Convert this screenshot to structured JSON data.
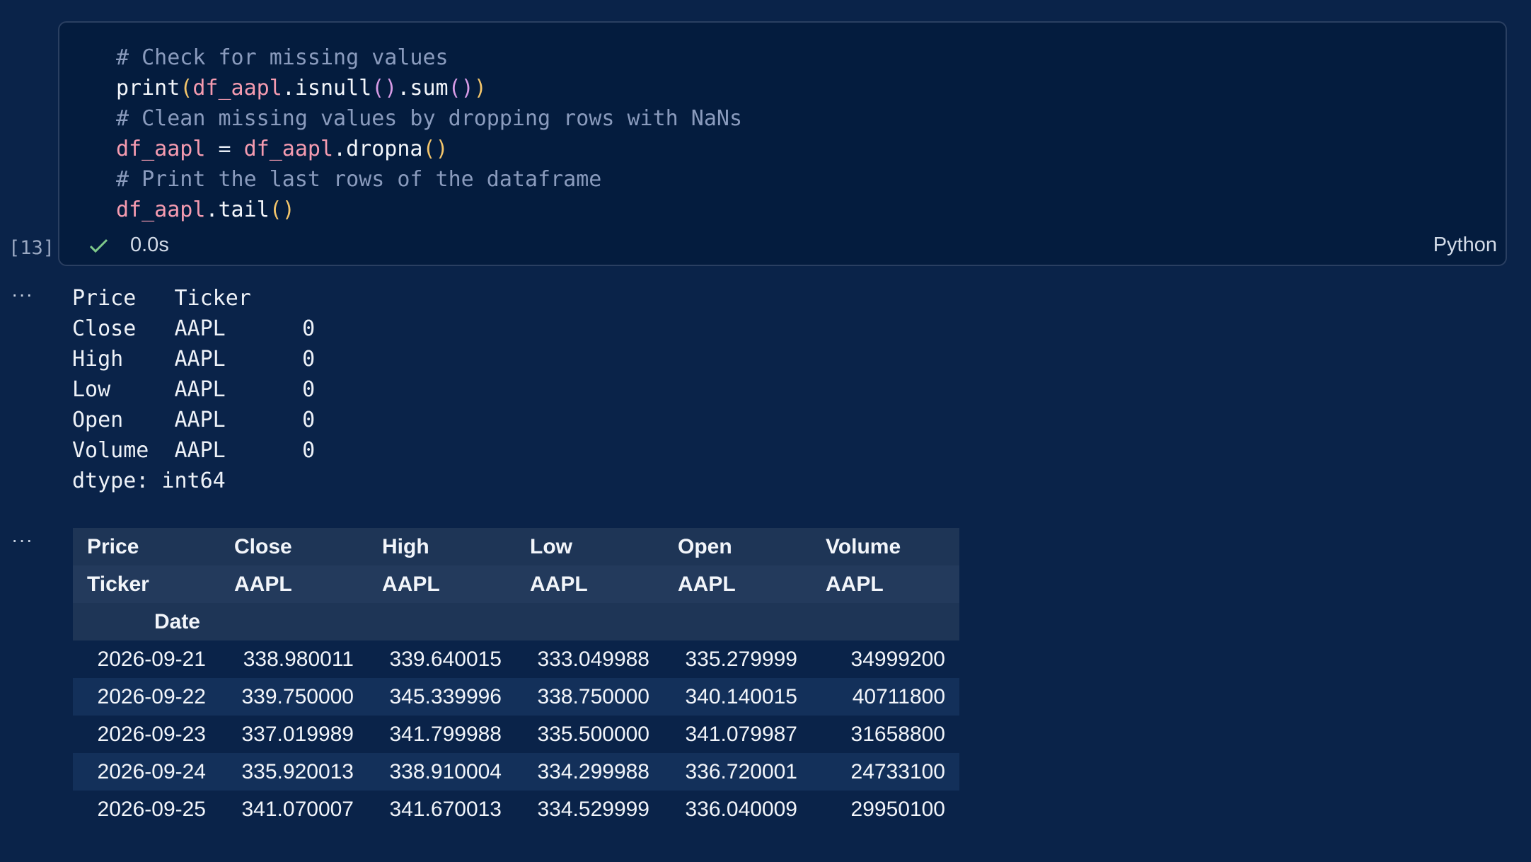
{
  "cell": {
    "execution_count": "[13]",
    "status_time": "0.0s",
    "language": "Python",
    "code": {
      "line1": "# Check for missing values",
      "line2": {
        "fn": "print",
        "var": "df_aapl",
        "method": ".isnull",
        "method2": ".sum"
      },
      "line3": "# Clean missing values by dropping rows with NaNs",
      "line4": {
        "target": "df_aapl",
        "eq": " = ",
        "var": "df_aapl",
        "method": ".dropna"
      },
      "line5": "# Print the last rows of the dataframe",
      "line6": {
        "var": "df_aapl",
        "method": ".tail"
      }
    }
  },
  "output_prompt": "···",
  "output1_text": "Price   Ticker\nClose   AAPL      0\nHigh    AAPL      0\nLow     AAPL      0\nOpen    AAPL      0\nVolume  AAPL      0\ndtype: int64",
  "table": {
    "header_row1": [
      "Price",
      "Close",
      "High",
      "Low",
      "Open",
      "Volume"
    ],
    "header_row2": [
      "Ticker",
      "AAPL",
      "AAPL",
      "AAPL",
      "AAPL",
      "AAPL"
    ],
    "header_row3": [
      "Date"
    ],
    "rows": [
      [
        "2026-09-21",
        "338.980011",
        "339.640015",
        "333.049988",
        "335.279999",
        "34999200"
      ],
      [
        "2026-09-22",
        "339.750000",
        "345.339996",
        "338.750000",
        "340.140015",
        "40711800"
      ],
      [
        "2026-09-23",
        "337.019989",
        "341.799988",
        "335.500000",
        "341.079987",
        "31658800"
      ],
      [
        "2026-09-24",
        "335.920013",
        "338.910004",
        "334.299988",
        "336.720001",
        "24733100"
      ],
      [
        "2026-09-25",
        "341.070007",
        "341.670013",
        "334.529999",
        "336.040009",
        "29950100"
      ]
    ]
  }
}
